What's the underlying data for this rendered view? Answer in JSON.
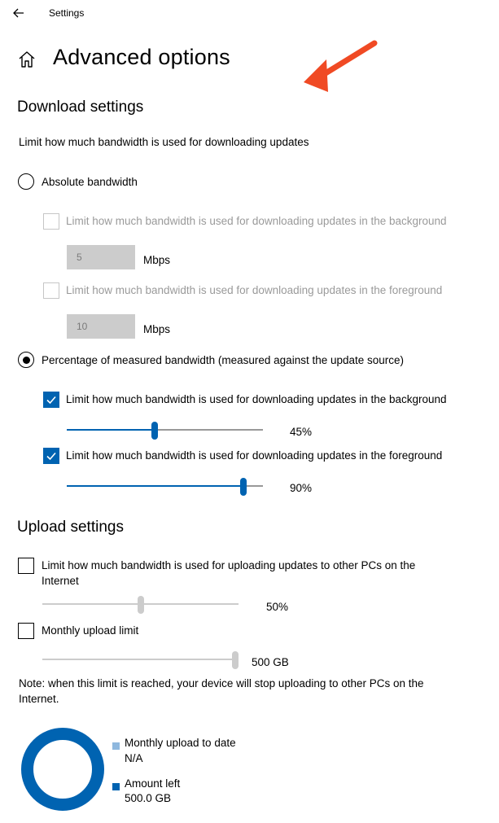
{
  "titlebar": {
    "title": "Settings"
  },
  "page": {
    "title": "Advanced options"
  },
  "download": {
    "title": "Download settings",
    "description": "Limit how much bandwidth is used for downloading updates",
    "absolute": {
      "label": "Absolute bandwidth",
      "selected": false,
      "background_label": "Limit how much bandwidth is used for downloading updates in the background",
      "background_value": "5",
      "foreground_label": "Limit how much bandwidth is used for downloading updates in the foreground",
      "foreground_value": "10",
      "unit": "Mbps"
    },
    "percentage": {
      "label": "Percentage of measured bandwidth (measured against the update source)",
      "selected": true,
      "background_label": "Limit how much bandwidth is used for downloading updates in the background",
      "background_checked": true,
      "background_percent": 45,
      "background_value_text": "45%",
      "foreground_label": "Limit how much bandwidth is used for downloading updates in the foreground",
      "foreground_checked": true,
      "foreground_percent": 90,
      "foreground_value_text": "90%"
    }
  },
  "upload": {
    "title": "Upload settings",
    "internet_label_line1": "Limit how much bandwidth is used for uploading updates to other PCs on the",
    "internet_label_line2": "Internet",
    "internet_checked": false,
    "internet_percent": 50,
    "internet_value_text": "50%",
    "monthly_label": "Monthly upload limit",
    "monthly_checked": false,
    "monthly_level": 1.0,
    "monthly_value_text": "500 GB",
    "note_line1": "Note: when this limit is reached, your device will stop uploading to other PCs on the",
    "note_line2": "Internet.",
    "legend": [
      {
        "label": "Monthly upload to date",
        "value": "N/A",
        "color": "#8fb8de"
      },
      {
        "label": "Amount left",
        "value": "500.0 GB",
        "color": "#0063b1"
      }
    ]
  },
  "colors": {
    "accent": "#0063b1",
    "disabled": "#cccccc",
    "arrow": "#f04a24"
  }
}
